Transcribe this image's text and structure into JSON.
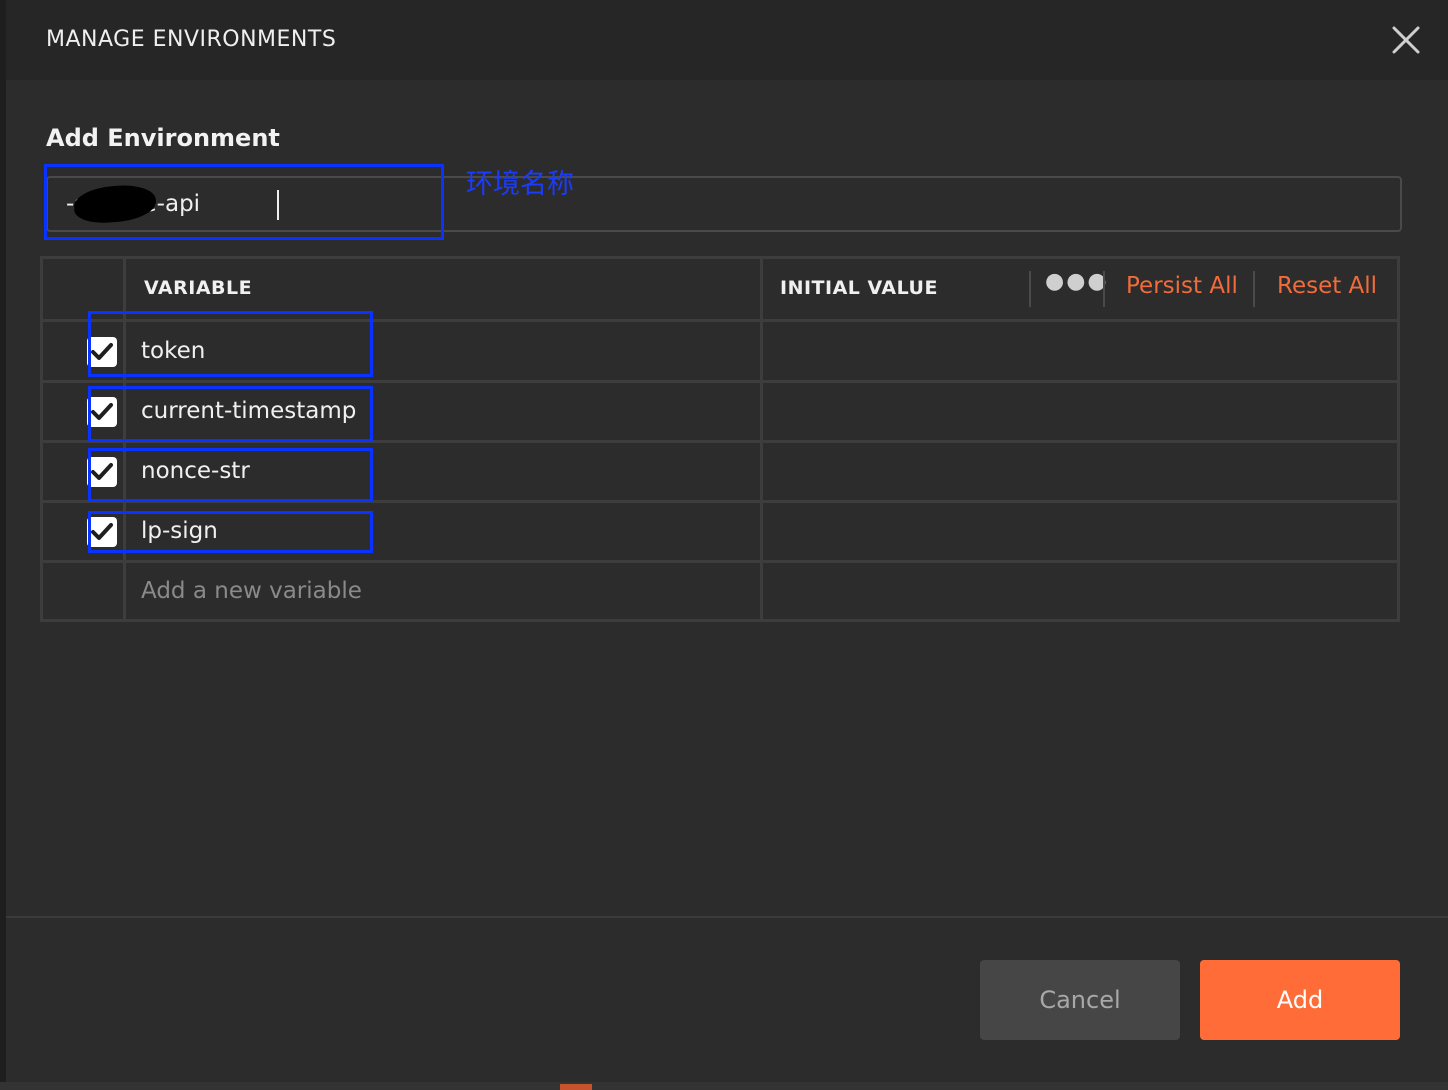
{
  "modal": {
    "title": "MANAGE ENVIRONMENTS",
    "close_icon": "close-icon"
  },
  "form": {
    "section_title": "Add Environment",
    "environment_name_value": "-service-api",
    "annotation_label": "环境名称"
  },
  "table": {
    "headers": {
      "variable": "VARIABLE",
      "initial_value": "INITIAL VALUE",
      "more_icon": "more-horizontal-icon",
      "persist_all": "Persist All",
      "reset_all": "Reset All"
    },
    "rows": [
      {
        "checked": true,
        "variable": "token",
        "initial_value": ""
      },
      {
        "checked": true,
        "variable": "current-timestamp",
        "initial_value": ""
      },
      {
        "checked": true,
        "variable": "nonce-str",
        "initial_value": ""
      },
      {
        "checked": true,
        "variable": "lp-sign",
        "initial_value": ""
      }
    ],
    "new_variable_placeholder": "Add a new variable"
  },
  "footer": {
    "cancel_label": "Cancel",
    "add_label": "Add"
  },
  "colors": {
    "accent": "#ff6c37",
    "link": "#f26b3a",
    "annotation": "#0a33ff",
    "background": "#2c2c2c"
  }
}
